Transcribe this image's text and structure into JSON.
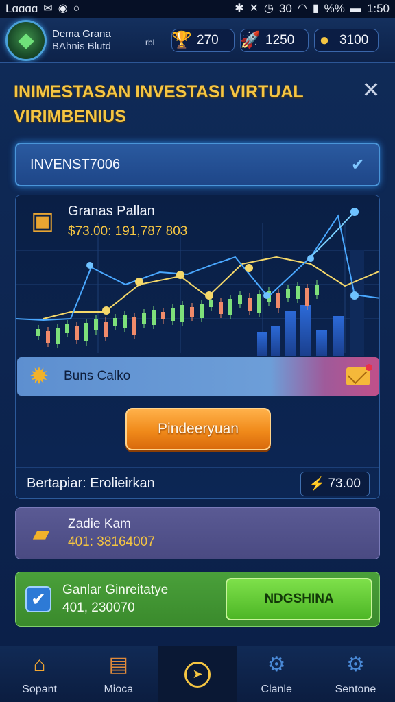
{
  "status_bar": {
    "carrier": "Lɑɑɑɑ",
    "left_icons": [
      "mail-icon",
      "headset-icon",
      "message-icon",
      "circle-icon"
    ],
    "right_icons": [
      "bluetooth-icon",
      "mute-icon",
      "alarm-icon"
    ],
    "signal_text": "30",
    "battery": "%%",
    "time": "1:50"
  },
  "header": {
    "user_name": "Dema Grana",
    "user_sub": "BAhnis Blutd",
    "level_tag": "rbl",
    "resources": [
      {
        "icon": "trophy-icon",
        "value": "270"
      },
      {
        "icon": "rocket-icon",
        "value": "1250"
      },
      {
        "icon": "coin-icon",
        "value": "3100"
      }
    ]
  },
  "modal": {
    "title": "INIMESTASAN INVESTASI VIRTUAL VIRIMBENIUS",
    "dropdown_value": "INVENST7006",
    "asset_name": "Granas Pallan",
    "asset_value": "$73.00: 191,787 803",
    "bonus_label": "Buns Calko",
    "action_button": "Pindeeryuan",
    "info_label": "Bertapiar: Erolieirkan",
    "info_value": "73.00",
    "card1": {
      "title": "Zadie Kam",
      "value": "401: 38164007"
    },
    "card2": {
      "title": "Ganlar Ginreitatye",
      "value": "401, 230070",
      "button": "NDGSHINA"
    }
  },
  "bottom_nav": [
    {
      "icon": "home-icon",
      "label": "Sopant"
    },
    {
      "icon": "box-icon",
      "label": "Mioca"
    },
    {
      "icon": "compass-icon",
      "label": ""
    },
    {
      "icon": "gear-icon",
      "label": "Clanle"
    },
    {
      "icon": "settings-icon",
      "label": "Sentone"
    }
  ],
  "colors": {
    "accent_gold": "#f5c542",
    "panel_blue": "#0b2049",
    "orange_button": "#f08a1a",
    "green_button": "#4db626"
  }
}
